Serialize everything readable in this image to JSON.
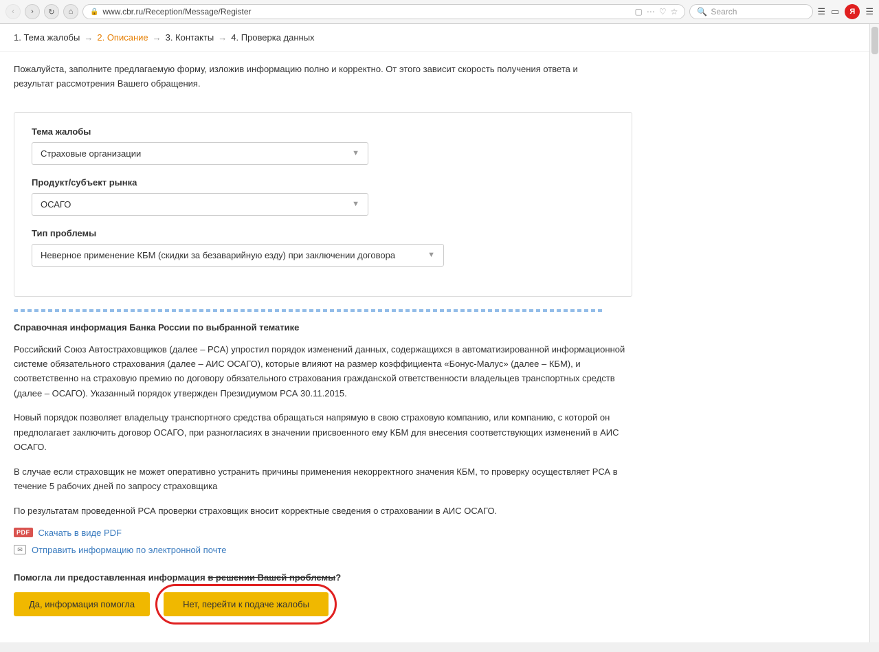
{
  "browser": {
    "url": "www.cbr.ru/Reception/Message/Register",
    "search_placeholder": "Search",
    "nav_back": "‹",
    "nav_forward": "›",
    "nav_reload": "↺",
    "nav_home": "⌂",
    "yandex_letter": "Я"
  },
  "steps": {
    "step1": "1. Тема жалобы",
    "arrow1": "→",
    "step2": "2. Описание",
    "arrow2": "→",
    "step3": "3. Контакты",
    "arrow3": "→",
    "step4": "4. Проверка данных"
  },
  "intro": {
    "text": "Пожалуйста, заполните предлагаемую форму, изложив информацию полно и корректно. От этого зависит скорость получения ответа и результат рассмотрения Вашего обращения."
  },
  "form": {
    "field1_label": "Тема жалобы",
    "field1_value": "Страховые организации",
    "field2_label": "Продукт/субъект рынка",
    "field2_value": "ОСАГО",
    "field3_label": "Тип проблемы",
    "field3_value": "Неверное применение КБМ (скидки за безаварийную езду) при заключении договора"
  },
  "info": {
    "title": "Справочная информация Банка России по выбранной тематике",
    "para1": "Российский Союз Автостраховщиков (далее – РСА) упростил порядок изменений данных, содержащихся в автоматизированной информационной системе обязательного страхования (далее – АИС ОСАГО), которые влияют на размер коэффициента «Бонус-Малус» (далее – КБМ), и соответственно на страховую премию по договору обязательного страхования гражданской ответственности владельцев транспортных средств (далее – ОСАГО). Указанный порядок утвержден Президиумом РСА 30.11.2015.",
    "para2": "Новый порядок позволяет владельцу транспортного средства обращаться напрямую в свою страховую компанию, или компанию, с которой он предполагает заключить договор ОСАГО, при разногласиях в значении присвоенного ему КБМ для внесения соответствующих изменений в АИС ОСАГО.",
    "para3": "В случае если страховщик не может оперативно устранить причины применения некорректного значения КБМ, то проверку осуществляет РСА в течение 5 рабочих дней по запросу страховщика",
    "para4": "По результатам проведенной РСА проверки страховщик вносит корректные сведения о страховании в АИС ОСАГО.",
    "pdf_link": "Скачать в виде PDF",
    "email_link": "Отправить информацию по электронной почте"
  },
  "question": {
    "text_normal": "Помогла ли предоставленная информация ",
    "text_strikethrough": "в решении Вашей проблемы",
    "text_end": "?",
    "btn_yes": "Да, информация помогла",
    "btn_no": "Нет, перейти к подаче жалобы"
  }
}
